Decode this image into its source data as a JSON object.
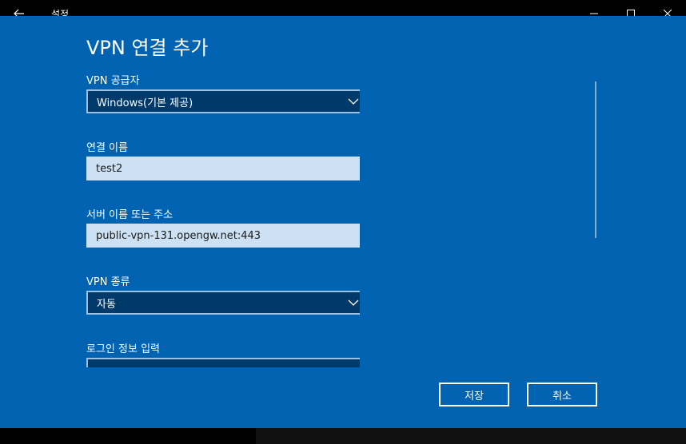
{
  "window": {
    "title": "설정"
  },
  "dialog": {
    "title": "VPN 연결 추가",
    "provider": {
      "label": "VPN 공급자",
      "value": "Windows(기본 제공)"
    },
    "connection_name": {
      "label": "연결 이름",
      "value": "test2"
    },
    "server": {
      "label": "서버 이름 또는 주소",
      "value": "public-vpn-131.opengw.net:443"
    },
    "vpn_type": {
      "label": "VPN 종류",
      "value": "자동"
    },
    "signin_info": {
      "label": "로그인 정보 입력"
    },
    "buttons": {
      "save": "저장",
      "cancel": "취소"
    }
  },
  "icons": {
    "back": "back-arrow-icon",
    "minimize": "minimize-icon",
    "maximize": "maximize-icon",
    "close": "close-icon",
    "dropdown": "chevron-down-icon"
  },
  "colors": {
    "accent": "#0063b1",
    "select_bg": "#003a6b",
    "textbox_bg": "#cce1f3"
  }
}
